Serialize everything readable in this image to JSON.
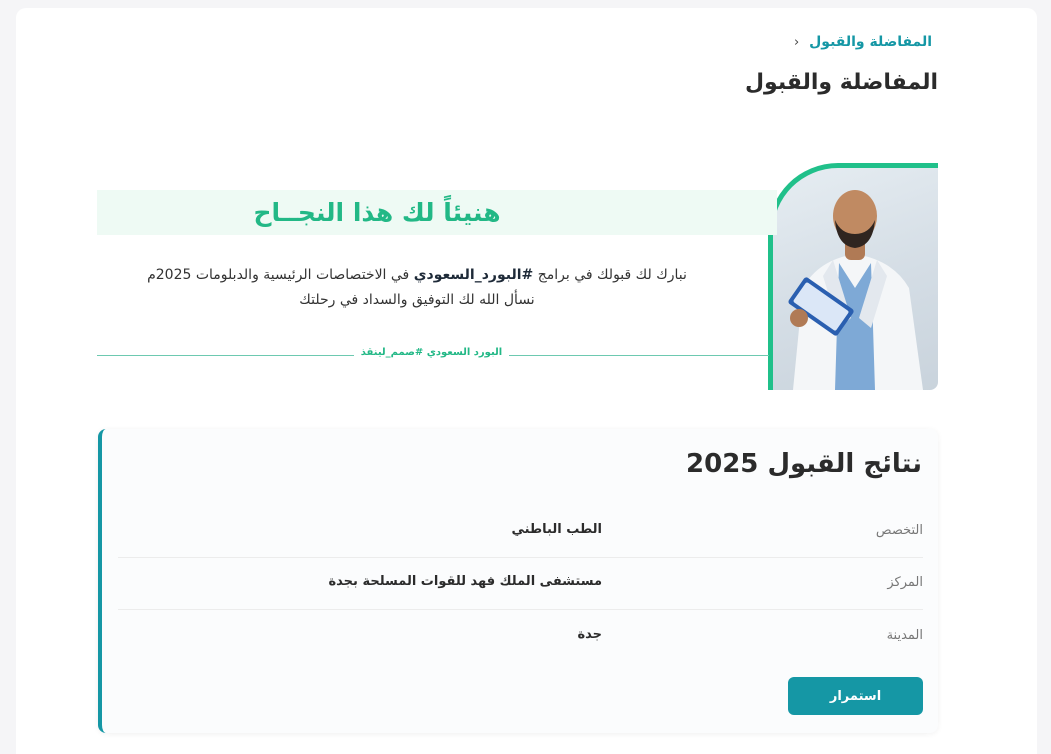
{
  "breadcrumb": {
    "current": "المفاضلة والقبول",
    "chevron_icon": "chevron-left-icon"
  },
  "page_title": "المفاضلة والقبول",
  "hero": {
    "title": "هنيئاً لك هذا النجــاح",
    "line1_prefix": "نبارك لك قبولك في برامج",
    "line1_hashtag": "#البورد_السعودي",
    "line1_suffix": "في الاختصاصات الرئيسية والدبلومات 2025م",
    "line2": "نسأل الله لك التوفيق والسداد في رحلتك",
    "signature": "البورد السعودي #صمم_لينقذ",
    "accent_color": "#20c08a"
  },
  "results": {
    "title": "نتائج القبول 2025",
    "rows": [
      {
        "label": "التخصص",
        "value": "الطب الباطني"
      },
      {
        "label": "المركز",
        "value": "مستشفى الملك فهد للقوات المسلحة بجدة"
      },
      {
        "label": "المدينة",
        "value": "جدة"
      }
    ],
    "continue_label": "استمرار",
    "accent_color": "#1597a5"
  }
}
